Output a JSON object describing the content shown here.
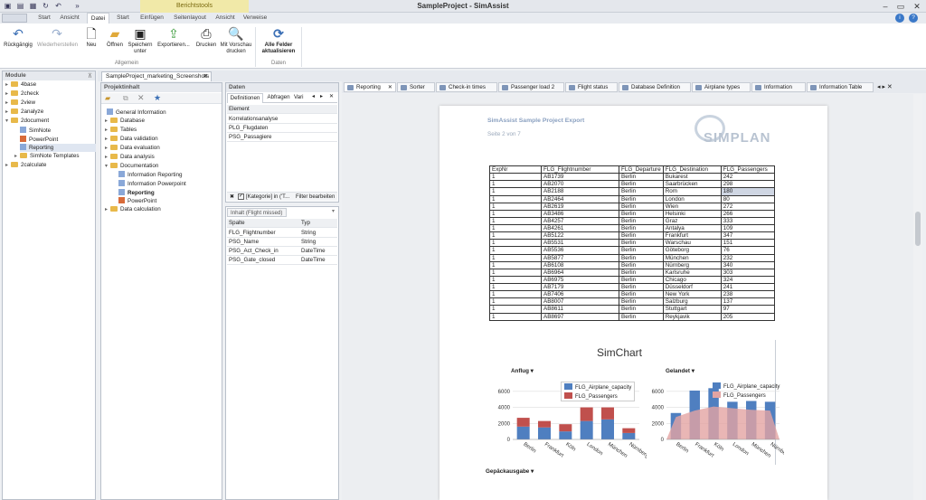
{
  "window": {
    "title": "SampleProject - SimAssist",
    "context_tab": "Berichtstools"
  },
  "ribbon_tabs": [
    "Start",
    "Ansicht",
    "Datei",
    "Start",
    "Einfügen",
    "Seitenlayout",
    "Ansicht",
    "Verweise"
  ],
  "ribbon": {
    "buttons": [
      "Rückgängig",
      "Wiederherstellen",
      "Neu",
      "Öffnen",
      "Speichern unter",
      "Exportieren...",
      "Drucken",
      "Mit Vorschau drucken",
      "Alle Felder aktualisieren"
    ],
    "groups": [
      "Allgemein",
      "Daten"
    ]
  },
  "modules": {
    "title": "Module",
    "items": [
      "4base",
      "2check",
      "2view",
      "2analyze",
      "2document",
      "SimNote",
      "PowerPoint",
      "Reporting",
      "SimNote Templates",
      "2calculate"
    ]
  },
  "doc_tab": {
    "label": "SampleProject_marketing_Screenshots"
  },
  "project": {
    "title": "Projektinhalt",
    "items": [
      "General Information",
      "Database",
      "Tables",
      "Data validation",
      "Data evaluation",
      "Data analysis",
      "Documentation",
      "Information Reporting",
      "Information Powerpoint",
      "Reporting",
      "PowerPoint",
      "Data calculation"
    ]
  },
  "daten": {
    "title": "Daten",
    "tabs": [
      "Definitionen",
      "Abfragen",
      "Vari"
    ],
    "header": "Element",
    "rows": [
      "Korrelationsanalyse",
      "PLG_Flugdaten",
      "PSG_Passagiere"
    ],
    "filter": "[Kategorie] in ('T...",
    "filter_edit": "Filter bearbeiten"
  },
  "inhalt": {
    "title": "Inhalt (Flight missed)",
    "columns": [
      "Spalte",
      "Typ"
    ],
    "rows": [
      [
        "FLG_Flightnumber",
        "String"
      ],
      [
        "PSG_Name",
        "String"
      ],
      [
        "PSG_Act_Check_in",
        "DateTime"
      ],
      [
        "PSG_Gate_closed",
        "DateTime"
      ]
    ]
  },
  "content_tabs": [
    "Reporting",
    "Sorter",
    "Check-in times",
    "Passenger load 2",
    "Flight status",
    "Database Definition",
    "Airplane types",
    "Information",
    "Information Table"
  ],
  "report": {
    "header": "SimAssist Sample Project Export",
    "page_label": "Seite 2 von 7",
    "logo": "SIMPLAN",
    "table": {
      "columns": [
        "ExpNr",
        "FLG_Flightnumber",
        "FLG_Departure",
        "FLG_Destination",
        "FLG_Passengers"
      ],
      "rows": [
        [
          "1",
          "AB1739",
          "Berlin",
          "Bukarest",
          "242"
        ],
        [
          "1",
          "AB2070",
          "Berlin",
          "Saarbrücken",
          "298"
        ],
        [
          "1",
          "AB2188",
          "Berlin",
          "Rom",
          "180"
        ],
        [
          "1",
          "AB2464",
          "Berlin",
          "London",
          "80"
        ],
        [
          "1",
          "AB2619",
          "Berlin",
          "Wien",
          "272"
        ],
        [
          "1",
          "AB3486",
          "Berlin",
          "Helsinki",
          "266"
        ],
        [
          "1",
          "AB4257",
          "Berlin",
          "Graz",
          "333"
        ],
        [
          "1",
          "AB4261",
          "Berlin",
          "Antalya",
          "109"
        ],
        [
          "1",
          "AB5122",
          "Berlin",
          "Frankfurt",
          "347"
        ],
        [
          "1",
          "AB5531",
          "Berlin",
          "Warschau",
          "151"
        ],
        [
          "1",
          "AB5536",
          "Berlin",
          "Göteborg",
          "76"
        ],
        [
          "1",
          "AB5877",
          "Berlin",
          "München",
          "232"
        ],
        [
          "1",
          "AB6108",
          "Berlin",
          "Nürnberg",
          "340"
        ],
        [
          "1",
          "AB6964",
          "Berlin",
          "Karlsruhe",
          "303"
        ],
        [
          "1",
          "AB6975",
          "Berlin",
          "Chicago",
          "324"
        ],
        [
          "1",
          "AB7179",
          "Berlin",
          "Düsseldorf",
          "241"
        ],
        [
          "1",
          "AB7406",
          "Berlin",
          "New York",
          "238"
        ],
        [
          "1",
          "AB8007",
          "Berlin",
          "Salzburg",
          "137"
        ],
        [
          "1",
          "AB8611",
          "Berlin",
          "Stuttgart",
          "97"
        ],
        [
          "1",
          "AB8697",
          "Berlin",
          "Reykjavik",
          "205"
        ]
      ]
    },
    "simchart_title": "SimChart",
    "next_section": "Gepäckausgabe"
  },
  "chart_data": [
    {
      "type": "bar",
      "title": "Anflug",
      "stacked": true,
      "categories": [
        "Berlin",
        "Frankfurt",
        "Köln",
        "London",
        "München",
        "Nürnberg"
      ],
      "series": [
        {
          "name": "FLG_Airplane_capacity",
          "values": [
            1600,
            1500,
            1000,
            2300,
            2500,
            800
          ]
        },
        {
          "name": "FLG_Passengers",
          "values": [
            1100,
            800,
            900,
            1700,
            1500,
            600
          ]
        }
      ],
      "ylim": [
        0,
        7000
      ],
      "yticks": [
        0,
        2000,
        4000,
        6000
      ],
      "legend": "top-right",
      "colors": [
        "#4f7fc0",
        "#c0504d"
      ]
    },
    {
      "type": "bar",
      "title": "Gelandet",
      "stacked": false,
      "categories": [
        "Berlin",
        "Frankfurt",
        "Köln",
        "London",
        "München",
        "Nürnberg"
      ],
      "series": [
        {
          "name": "FLG_Airplane_capacity",
          "values": [
            3300,
            6100,
            6400,
            4700,
            4800,
            4700
          ]
        },
        {
          "name": "FLG_Passengers",
          "values": [
            2800,
            3600,
            4100,
            3900,
            3700,
            3600
          ]
        }
      ],
      "ylim": [
        0,
        7000
      ],
      "yticks": [
        0,
        2000,
        4000,
        6000
      ],
      "legend": "top-right",
      "colors": [
        "#4f7fc0",
        "#e3a4a3"
      ]
    }
  ]
}
